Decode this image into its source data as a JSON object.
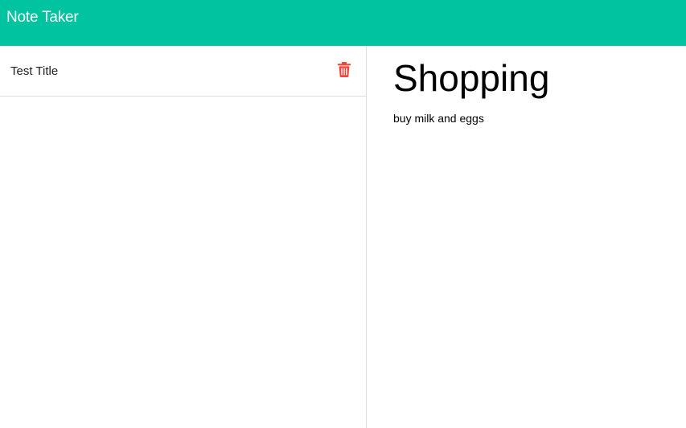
{
  "navbar": {
    "brand": "Note Taker",
    "background_color": "#00c3a0"
  },
  "notes_list": {
    "items": [
      {
        "title": "Test Title",
        "delete_icon": "trash-icon",
        "delete_icon_color": "#f44336"
      }
    ]
  },
  "editor": {
    "title_value": "Shopping",
    "body_value": "buy milk and eggs"
  }
}
